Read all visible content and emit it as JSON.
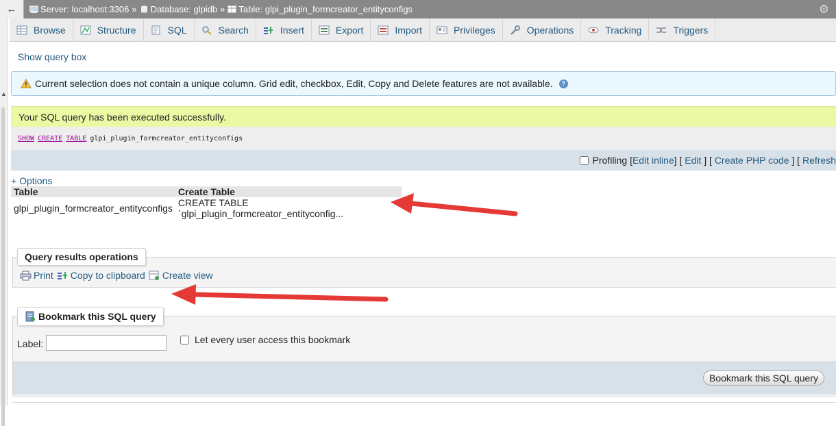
{
  "breadcrumb": {
    "back_label": "←",
    "server": "Server: localhost:3306",
    "database": "Database: glpidb",
    "table": "Table: glpi_plugin_formcreator_entityconfigs",
    "separator": "»"
  },
  "tabs": [
    {
      "label": "Browse",
      "icon": "browse-icon"
    },
    {
      "label": "Structure",
      "icon": "structure-icon"
    },
    {
      "label": "SQL",
      "icon": "sql-icon"
    },
    {
      "label": "Search",
      "icon": "search-icon"
    },
    {
      "label": "Insert",
      "icon": "insert-icon"
    },
    {
      "label": "Export",
      "icon": "export-icon"
    },
    {
      "label": "Import",
      "icon": "import-icon"
    },
    {
      "label": "Privileges",
      "icon": "privileges-icon"
    },
    {
      "label": "Operations",
      "icon": "wrench-icon"
    },
    {
      "label": "Tracking",
      "icon": "eye-icon"
    },
    {
      "label": "Triggers",
      "icon": "triggers-icon"
    }
  ],
  "show_query_box": "Show query box",
  "notice": "Current selection does not contain a unique column. Grid edit, checkbox, Edit, Copy and Delete features are not available.",
  "success_message": "Your SQL query has been executed successfully.",
  "sql": {
    "kw1": "SHOW",
    "kw2": "CREATE",
    "kw3": "TABLE",
    "table_name": "glpi_plugin_formcreator_entityconfigs"
  },
  "sql_actions": {
    "profiling": "Profiling",
    "edit_inline": "Edit inline",
    "edit": "Edit",
    "create_php": "Create PHP code",
    "refresh": "Refresh"
  },
  "options_link": "+ Options",
  "result_table": {
    "headers": [
      "Table",
      "Create Table"
    ],
    "rows": [
      [
        "glpi_plugin_formcreator_entityconfigs",
        "CREATE TABLE `glpi_plugin_formcreator_entityconfig..."
      ]
    ]
  },
  "query_results_operations": {
    "legend": "Query results operations",
    "print": "Print",
    "copy": "Copy to clipboard",
    "create_view": "Create view"
  },
  "bookmark": {
    "legend": "Bookmark this SQL query",
    "label": "Label:",
    "label_value": "",
    "share_label": "Let every user access this bookmark",
    "button": "Bookmark this SQL query"
  },
  "colors": {
    "link": "#235a81",
    "annotation_arrow": "#e53935",
    "success_bg": "#ebf8a4",
    "notice_bg": "#ebf8fd"
  }
}
